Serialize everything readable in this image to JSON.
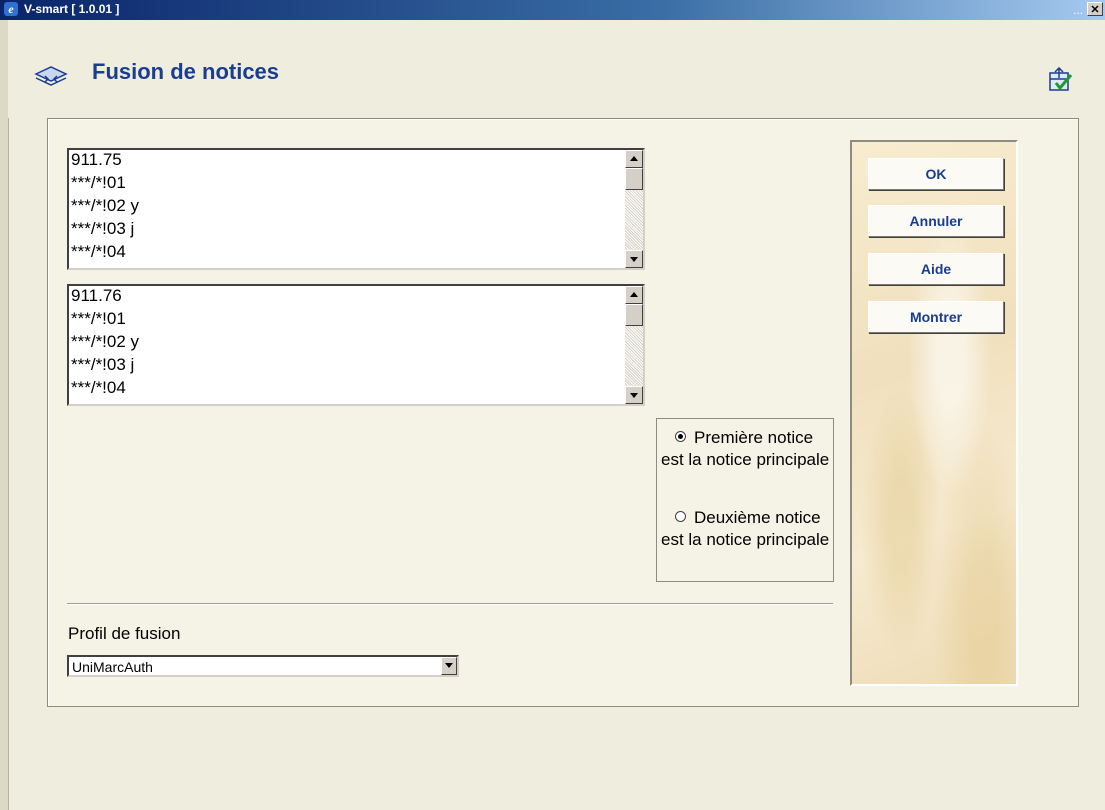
{
  "window": {
    "title": "V-smart [ 1.0.01 ]",
    "dots": "...",
    "close_glyph": "✕"
  },
  "header": {
    "title": "Fusion de notices"
  },
  "records": [
    {
      "lines": [
        "911.75",
        "***/*!01",
        "***/*!02 y",
        "***/*!03 j",
        "***/*!04"
      ]
    },
    {
      "lines": [
        "911.76",
        "***/*!01",
        "***/*!02 y",
        "***/*!03 j",
        "***/*!04"
      ]
    }
  ],
  "radio": {
    "first": {
      "label": "Première notice est la notice principale",
      "checked": true
    },
    "second": {
      "label": "Deuxième notice est la notice principale",
      "checked": false
    }
  },
  "profile": {
    "label": "Profil de fusion",
    "value": "UniMarcAuth"
  },
  "buttons": {
    "ok": "OK",
    "cancel": "Annuler",
    "help": "Aide",
    "show": "Montrer"
  },
  "colors": {
    "accent": "#1a3d8f",
    "background": "#efedde"
  }
}
